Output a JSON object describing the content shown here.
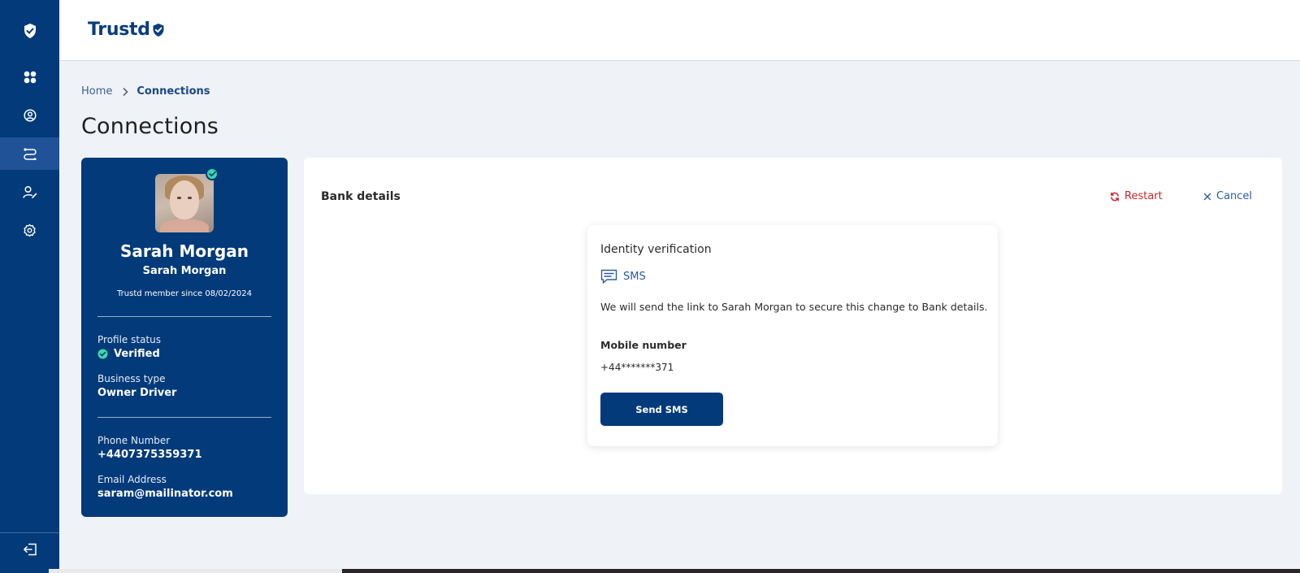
{
  "app": {
    "logo_text": "Trustd"
  },
  "colors": {
    "brand": "#033a7a",
    "accent_link": "#2a5aa0",
    "danger": "#c9272b",
    "success": "#3fd6a9"
  },
  "rail": {
    "items": [
      {
        "icon": "shield-check-icon"
      },
      {
        "icon": "dashboard-icon"
      },
      {
        "icon": "user-circle-icon"
      },
      {
        "icon": "connections-icon",
        "active": true
      },
      {
        "icon": "user-edit-icon"
      },
      {
        "icon": "settings-icon"
      },
      {
        "icon": "logout-icon"
      }
    ]
  },
  "breadcrumb": {
    "home": "Home",
    "current": "Connections"
  },
  "page": {
    "title": "Connections"
  },
  "profile": {
    "display_name": "Sarah Morgan",
    "sub_name": "Sarah Morgan",
    "member_since": "Trustd member since 08/02/2024",
    "status_label": "Profile status",
    "status_value": "Verified",
    "business_label": "Business type",
    "business_value": "Owner Driver",
    "phone_label": "Phone Number",
    "phone_value": "+4407375359371",
    "email_label": "Email Address",
    "email_value": "saram@mailinator.com"
  },
  "panel": {
    "section_title": "Bank details",
    "restart_label": "Restart",
    "cancel_label": "Cancel"
  },
  "verification": {
    "title": "Identity verification",
    "method": "SMS",
    "description": "We will send the link to Sarah Morgan to secure this change to Bank details.",
    "mobile_label": "Mobile number",
    "mobile_value": "+44*******371",
    "send_button": "Send SMS"
  }
}
